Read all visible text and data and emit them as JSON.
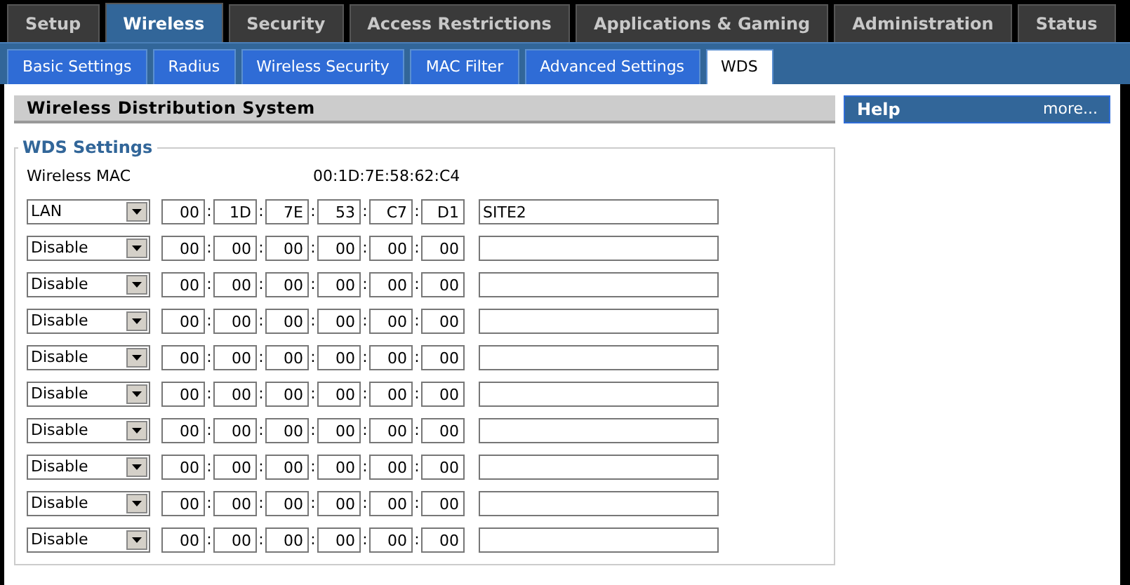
{
  "main_tabs": [
    {
      "label": "Setup",
      "selected": false
    },
    {
      "label": "Wireless",
      "selected": true
    },
    {
      "label": "Security",
      "selected": false
    },
    {
      "label": "Access Restrictions",
      "selected": false
    },
    {
      "label": "Applications & Gaming",
      "selected": false
    },
    {
      "label": "Administration",
      "selected": false
    },
    {
      "label": "Status",
      "selected": false
    }
  ],
  "sub_tabs": [
    {
      "label": "Basic Settings",
      "selected": false
    },
    {
      "label": "Radius",
      "selected": false
    },
    {
      "label": "Wireless Security",
      "selected": false
    },
    {
      "label": "MAC Filter",
      "selected": false
    },
    {
      "label": "Advanced Settings",
      "selected": false
    },
    {
      "label": "WDS",
      "selected": true
    }
  ],
  "section_title": "Wireless Distribution System",
  "fieldset_legend": "WDS Settings",
  "wireless_mac": {
    "label": "Wireless MAC",
    "value": "00:1D:7E:58:62:C4"
  },
  "mac_separator": ":",
  "wds_rows": [
    {
      "mode": "LAN",
      "mac": [
        "00",
        "1D",
        "7E",
        "53",
        "C7",
        "D1"
      ],
      "name": "SITE2"
    },
    {
      "mode": "Disable",
      "mac": [
        "00",
        "00",
        "00",
        "00",
        "00",
        "00"
      ]
    },
    {
      "mode": "Disable",
      "mac": [
        "00",
        "00",
        "00",
        "00",
        "00",
        "00"
      ]
    },
    {
      "mode": "Disable",
      "mac": [
        "00",
        "00",
        "00",
        "00",
        "00",
        "00"
      ]
    },
    {
      "mode": "Disable",
      "mac": [
        "00",
        "00",
        "00",
        "00",
        "00",
        "00"
      ]
    },
    {
      "mode": "Disable",
      "mac": [
        "00",
        "00",
        "00",
        "00",
        "00",
        "00"
      ]
    },
    {
      "mode": "Disable",
      "mac": [
        "00",
        "00",
        "00",
        "00",
        "00",
        "00"
      ]
    },
    {
      "mode": "Disable",
      "mac": [
        "00",
        "00",
        "00",
        "00",
        "00",
        "00"
      ]
    },
    {
      "mode": "Disable",
      "mac": [
        "00",
        "00",
        "00",
        "00",
        "00",
        "00"
      ]
    },
    {
      "mode": "Disable",
      "mac": [
        "00",
        "00",
        "00",
        "00",
        "00",
        "00"
      ]
    }
  ],
  "help": {
    "title": "Help",
    "link": "more..."
  }
}
